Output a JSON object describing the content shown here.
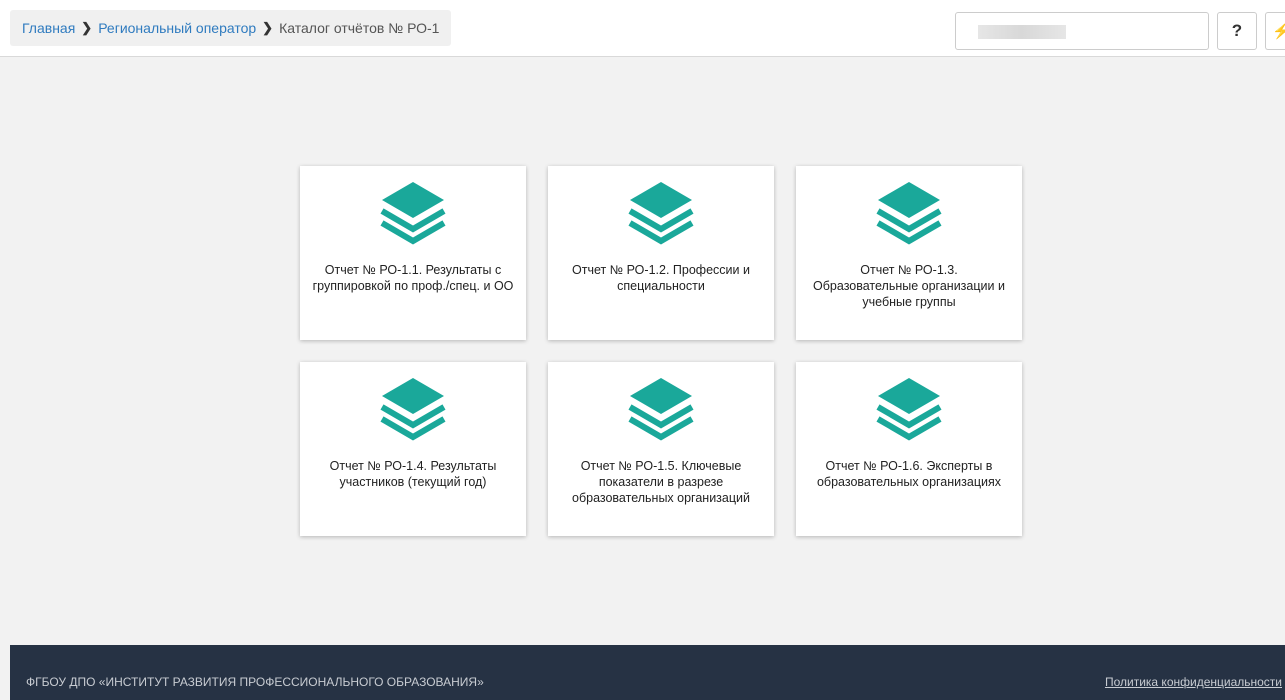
{
  "breadcrumb": {
    "items": [
      {
        "label": "Главная"
      },
      {
        "label": "Региональный оператор"
      },
      {
        "label": "Каталог отчётов № РО-1"
      }
    ]
  },
  "header": {
    "help_label": "?",
    "extra_label": "⚡"
  },
  "cards": [
    {
      "label": "Отчет № РО-1.1. Результаты с группировкой по проф./спец. и ОО",
      "icon": "layers-icon"
    },
    {
      "label": "Отчет № РО-1.2. Профессии и специальности",
      "icon": "layers-icon"
    },
    {
      "label": "Отчет № РО-1.3. Образовательные организации и учебные группы",
      "icon": "layers-icon"
    },
    {
      "label": "Отчет № РО-1.4. Результаты участников (текущий год)",
      "icon": "layers-icon"
    },
    {
      "label": "Отчет № РО-1.5. Ключевые показатели в разрезе образовательных организаций",
      "icon": "layers-icon"
    },
    {
      "label": "Отчет № РО-1.6. Эксперты в образовательных организациях",
      "icon": "layers-icon"
    }
  ],
  "footer": {
    "org": "ФГБОУ ДПО «ИНСТИТУТ РАЗВИТИЯ ПРОФЕССИОНАЛЬНОГО ОБРАЗОВАНИЯ»",
    "privacy_link": "Политика конфиденциальности"
  },
  "colors": {
    "accent": "#1aa89a",
    "link": "#2f7bbf",
    "footer_bg": "#263244"
  }
}
